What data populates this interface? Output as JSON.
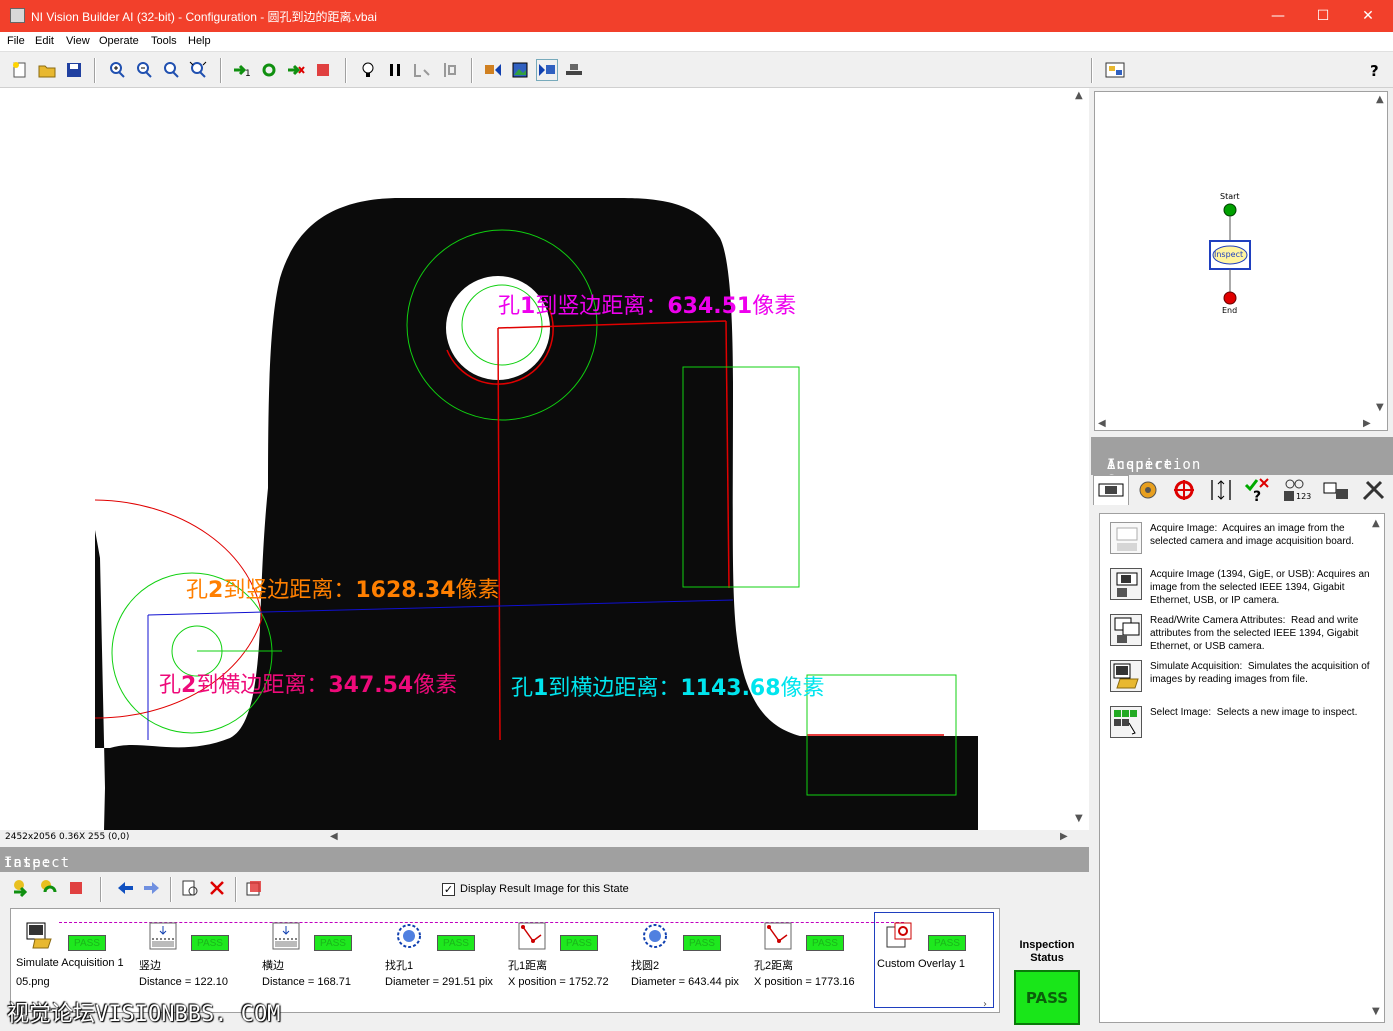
{
  "window": {
    "title": "NI Vision Builder AI (32-bit) - Configuration - 圆孔到边的距离.vbai",
    "minimize": "—",
    "maximize": "☐",
    "close": "✕"
  },
  "menu": [
    "File",
    "Edit",
    "View",
    "Operate",
    "Tools",
    "Help"
  ],
  "toolbar": {
    "icons": [
      "new-file",
      "open-file",
      "save",
      "zoom-in",
      "zoom-out",
      "zoom-1to1",
      "zoom-fit",
      "run-once",
      "run-continuous",
      "run-inspection-step",
      "stop",
      "light-bulb",
      "pause",
      "step-highlight",
      "step-back",
      "image-left",
      "image-show",
      "image-next",
      "image-belt",
      "flowchart-view",
      "help"
    ]
  },
  "image": {
    "status_left": "2452x2056 0.36X 255",
    "status_coord": "(0,0)",
    "labels": [
      {
        "prefix": "孔",
        "num": "1",
        "mid": "到竖边距离：",
        "value": "634.51",
        "suffix": "像素",
        "color": "#ee00ee"
      },
      {
        "prefix": "孔",
        "num": "2",
        "mid": "到竖边距离：",
        "value": "1628.34",
        "suffix": "像素",
        "color": "#ff7f00"
      },
      {
        "prefix": "孔",
        "num": "2",
        "mid": "到横边距离：",
        "value": "347.54",
        "suffix": "像素",
        "color": "#ee0a7a"
      },
      {
        "prefix": "孔",
        "num": "1",
        "mid": "到横边距离：",
        "value": "1143.68",
        "suffix": "像素",
        "color": "#00e5ee"
      }
    ]
  },
  "state": {
    "label": "tate:",
    "name": "Inspect"
  },
  "display_result": {
    "label": "Display Result Image for this State",
    "checked": true
  },
  "steps": [
    {
      "name": "Simulate Acquisition 1",
      "result": "05.png",
      "status": "PASS",
      "icon": "simulate-acquisition-icon"
    },
    {
      "name": "竖边",
      "result": "Distance = 122.10",
      "status": "PASS",
      "icon": "edge-find-icon"
    },
    {
      "name": "横边",
      "result": "Distance = 168.71",
      "status": "PASS",
      "icon": "edge-find-icon"
    },
    {
      "name": "找孔1",
      "result": "Diameter = 291.51 pix",
      "status": "PASS",
      "icon": "find-circle-icon"
    },
    {
      "name": "孔1距离",
      "result": "X position = 1752.72",
      "status": "PASS",
      "icon": "geometry-icon"
    },
    {
      "name": "找圆2",
      "result": "Diameter = 643.44 pix",
      "status": "PASS",
      "icon": "find-circle-icon"
    },
    {
      "name": "孔2距离",
      "result": "X position = 1773.16",
      "status": "PASS",
      "icon": "geometry-icon"
    },
    {
      "name": "Custom Overlay 1",
      "result": "",
      "status": "PASS",
      "icon": "custom-overlay-icon"
    }
  ],
  "inspection_status": {
    "title": "Inspection",
    "subtitle": "Status",
    "value": "PASS"
  },
  "flowchart": {
    "start": "Start",
    "state": "Inspect",
    "end": "End"
  },
  "inspection_steps": {
    "header": "Inspection Steps:",
    "category": "Acquire",
    "tabs": [
      "acquire-tab-icon",
      "enhance-tab-icon",
      "locate-tab-icon",
      "measure-tab-icon",
      "check-tab-icon",
      "identify-tab-icon",
      "communicate-tab-icon",
      "tools-tab-icon"
    ],
    "items": [
      {
        "title": "Acquire Image:",
        "desc": "Acquires an image from the selected camera and image acquisition board."
      },
      {
        "title": "Acquire Image (1394, GigE, or USB):",
        "desc": "Acquires an image from the selected IEEE 1394, Gigabit Ethernet, USB, or IP camera."
      },
      {
        "title": "Read/Write Camera Attributes:",
        "desc": "Read and write attributes from the selected IEEE 1394, Gigabit Ethernet, or USB camera."
      },
      {
        "title": "Simulate Acquisition:",
        "desc": "Simulates the acquisition of images by reading images from file."
      },
      {
        "title": "Select Image:",
        "desc": "Selects a new image to inspect."
      }
    ]
  },
  "watermark": "视觉论坛VISIONBBS. COM",
  "colors": {
    "titlebar": "#f2402b",
    "pass": "#1ee81e",
    "state_bar": "#a0a0a0"
  }
}
